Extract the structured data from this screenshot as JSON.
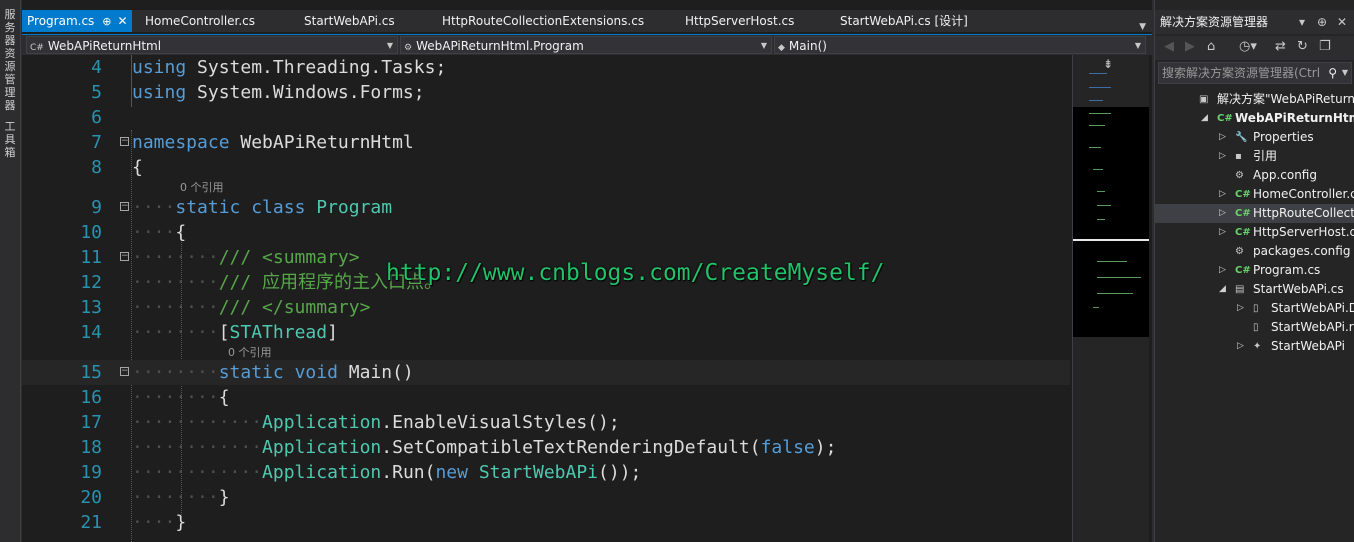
{
  "left_strip": {
    "tabs": [
      "服务器资源管理器",
      "工具箱"
    ]
  },
  "tabs": [
    {
      "label": "Program.cs",
      "pin": "⊕",
      "close": "✕"
    },
    {
      "label": "HomeController.cs"
    },
    {
      "label": "StartWebAPi.cs"
    },
    {
      "label": "HttpRouteCollectionExtensions.cs"
    },
    {
      "label": "HttpServerHost.cs"
    },
    {
      "label": "StartWebAPi.cs [设计]"
    }
  ],
  "tab_menu": "▼",
  "navbar": {
    "project": "WebAPiReturnHtml",
    "type": "WebAPiReturnHtml.Program",
    "member": "Main()",
    "project_icon": "C#"
  },
  "code": {
    "lines": [
      {
        "n": "4",
        "parts": [
          [
            "kw",
            "using "
          ],
          [
            "df",
            "System.Threading.Tasks;"
          ]
        ]
      },
      {
        "n": "5",
        "parts": [
          [
            "kw",
            "using "
          ],
          [
            "df",
            "System.Windows.Forms;"
          ]
        ]
      },
      {
        "n": "6",
        "parts": []
      },
      {
        "n": "7",
        "fold": "−",
        "parts": [
          [
            "kw",
            "namespace "
          ],
          [
            "df",
            "WebAPiReturnHtml"
          ]
        ]
      },
      {
        "n": "8",
        "parts": [
          [
            "df",
            "{"
          ]
        ]
      },
      {
        "n": "9",
        "fold": "−",
        "lens": "0 个引用",
        "parts": [
          [
            "ws",
            "····"
          ],
          [
            "kw",
            "static "
          ],
          [
            "kw",
            "class "
          ],
          [
            "ty",
            "Program"
          ]
        ]
      },
      {
        "n": "10",
        "parts": [
          [
            "ws",
            "····"
          ],
          [
            "df",
            "{"
          ]
        ]
      },
      {
        "n": "11",
        "fold": "−",
        "parts": [
          [
            "ws",
            "········"
          ],
          [
            "cm",
            "/// <summary>"
          ]
        ]
      },
      {
        "n": "12",
        "parts": [
          [
            "ws",
            "········"
          ],
          [
            "cm",
            "/// 应用程序的主入口点。"
          ]
        ]
      },
      {
        "n": "13",
        "parts": [
          [
            "ws",
            "········"
          ],
          [
            "cm",
            "/// </summary>"
          ]
        ]
      },
      {
        "n": "14",
        "parts": [
          [
            "ws",
            "········"
          ],
          [
            "df",
            "["
          ],
          [
            "ty",
            "STAThread"
          ],
          [
            "df",
            "]"
          ]
        ]
      },
      {
        "n": "15",
        "fold": "−",
        "current": true,
        "lens": "0 个引用",
        "parts": [
          [
            "ws",
            "········"
          ],
          [
            "kw",
            "static "
          ],
          [
            "kw",
            "void "
          ],
          [
            "df",
            "Main()"
          ]
        ]
      },
      {
        "n": "16",
        "parts": [
          [
            "ws",
            "········"
          ],
          [
            "df",
            "{"
          ]
        ]
      },
      {
        "n": "17",
        "parts": [
          [
            "ws",
            "············"
          ],
          [
            "ty",
            "Application"
          ],
          [
            "df",
            ".EnableVisualStyles();"
          ]
        ]
      },
      {
        "n": "18",
        "parts": [
          [
            "ws",
            "············"
          ],
          [
            "ty",
            "Application"
          ],
          [
            "df",
            ".SetCompatibleTextRenderingDefault("
          ],
          [
            "kw",
            "false"
          ],
          [
            "df",
            ");"
          ]
        ]
      },
      {
        "n": "19",
        "parts": [
          [
            "ws",
            "············"
          ],
          [
            "ty",
            "Application"
          ],
          [
            "df",
            ".Run("
          ],
          [
            "kw",
            "new "
          ],
          [
            "ty",
            "StartWebAPi"
          ],
          [
            "df",
            "());"
          ]
        ]
      },
      {
        "n": "20",
        "parts": [
          [
            "ws",
            "········"
          ],
          [
            "df",
            "}"
          ]
        ]
      },
      {
        "n": "21",
        "parts": [
          [
            "ws",
            "····"
          ],
          [
            "df",
            "}"
          ]
        ]
      }
    ]
  },
  "watermark": "http://www.cnblogs.com/CreateMyself/",
  "minimap": {
    "splitter_icon": "split-icon"
  },
  "solution_explorer": {
    "title": "解决方案资源管理器",
    "title_buttons": [
      "▾",
      "⊕",
      "✕"
    ],
    "search_placeholder": "搜索解决方案资源管理器(Ctrl",
    "search_icon": "⚲",
    "tree": [
      {
        "label": "解决方案\"WebAPiReturnHtml\"",
        "icon": "▣",
        "depth": 0
      },
      {
        "label": "WebAPiReturnHtml",
        "icon": "C#",
        "depth": 1,
        "expanded": true,
        "bold": true
      },
      {
        "label": "Properties",
        "icon": "🔧",
        "depth": 2,
        "collapsed": true
      },
      {
        "label": "引用",
        "icon": "▪",
        "depth": 2,
        "collapsed": true
      },
      {
        "label": "App.config",
        "icon": "⚙",
        "depth": 2
      },
      {
        "label": "HomeController.cs",
        "icon": "C#",
        "depth": 2,
        "collapsed": true
      },
      {
        "label": "HttpRouteCollectionExtensions.cs",
        "icon": "C#",
        "depth": 2,
        "collapsed": true,
        "selected": true
      },
      {
        "label": "HttpServerHost.cs",
        "icon": "C#",
        "depth": 2,
        "collapsed": true
      },
      {
        "label": "packages.config",
        "icon": "⚙",
        "depth": 2
      },
      {
        "label": "Program.cs",
        "icon": "C#",
        "depth": 2,
        "collapsed": true
      },
      {
        "label": "StartWebAPi.cs",
        "icon": "▤",
        "depth": 2,
        "expanded": true
      },
      {
        "label": "StartWebAPi.Designer.cs",
        "icon": "▯",
        "depth": 3,
        "collapsed": true
      },
      {
        "label": "StartWebAPi.resx",
        "icon": "▯",
        "depth": 3
      },
      {
        "label": "StartWebAPi",
        "icon": "✦",
        "depth": 3,
        "collapsed": true
      }
    ]
  },
  "colors": {
    "accent": "#007acc",
    "keyword": "#569cd6",
    "type": "#4ec9b0",
    "comment": "#57a64a",
    "line_number": "#2b91af",
    "watermark": "#22c26a"
  }
}
